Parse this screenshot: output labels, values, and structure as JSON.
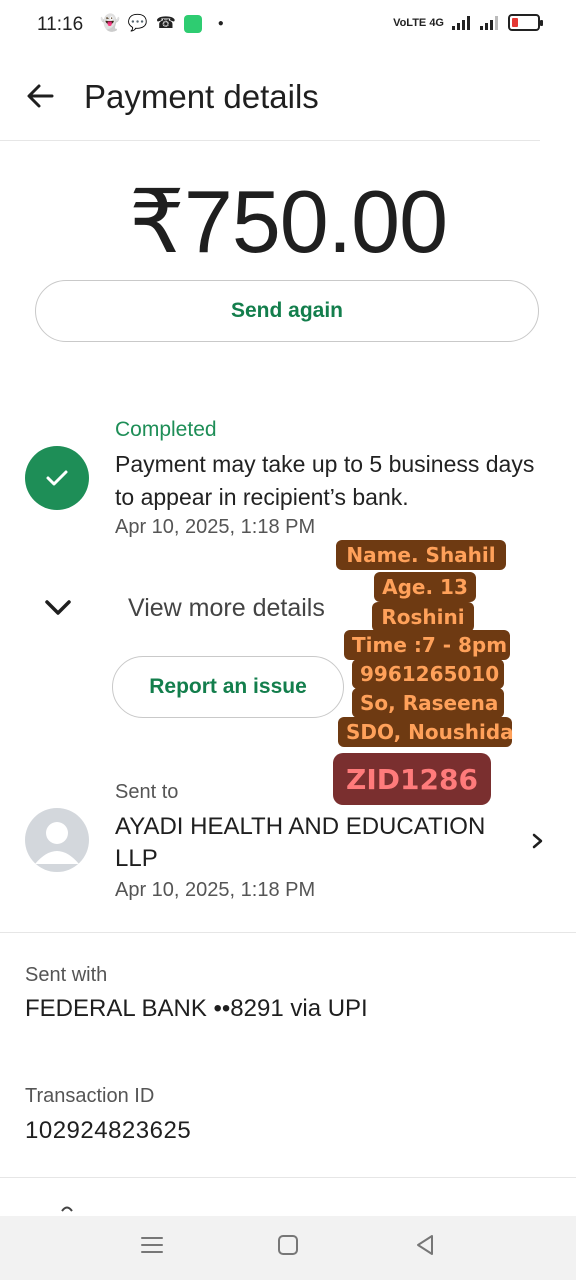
{
  "status_bar": {
    "time": "11:16",
    "icons": [
      "snapchat-icon",
      "chat-icon",
      "missed-call-icon",
      "app-icon",
      "dot-icon"
    ],
    "network": "VoLTE 4G",
    "battery_color": "#e53935"
  },
  "header": {
    "title": "Payment details"
  },
  "amount": "₹750.00",
  "actions": {
    "send_again": "Send again",
    "report_issue": "Report an issue"
  },
  "status": {
    "label": "Completed",
    "message": "Payment may take up to 5 business days to appear in recipient’s bank.",
    "timestamp": "Apr 10, 2025, 1:18 PM"
  },
  "view_more": "View more details",
  "overlay": {
    "lines": [
      "Name. Shahil",
      "Age. 13",
      "Roshini",
      "Time :7 - 8pm",
      "9961265010",
      "So, Raseena",
      "SDO, Noushida"
    ],
    "code": "ZID1286"
  },
  "recipient": {
    "label": "Sent to",
    "name": "AYADI HEALTH AND EDUCATION LLP",
    "timestamp": "Apr 10, 2025, 1:18 PM"
  },
  "sent_with": {
    "label": "Sent with",
    "value": "FEDERAL BANK ••8291 via UPI"
  },
  "transaction": {
    "label": "Transaction ID",
    "value": "102924823625"
  },
  "colors": {
    "accent_green": "#1e8e57",
    "sticker_bg": "#6e3a12",
    "sticker_text": "#ffa15a"
  }
}
